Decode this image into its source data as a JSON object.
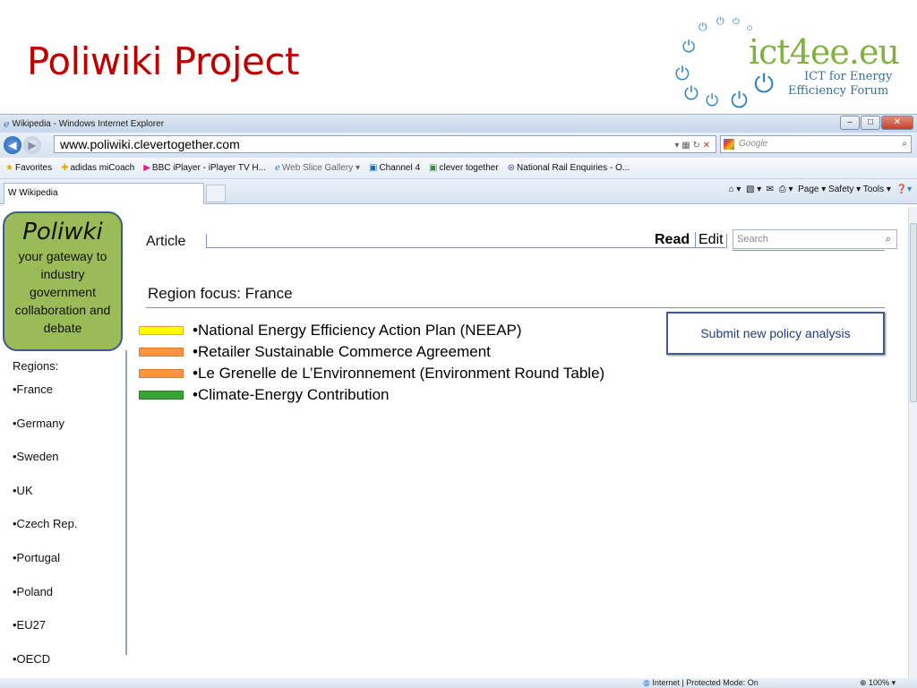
{
  "slide": {
    "title": "Poliwiki Project"
  },
  "logo": {
    "name": "ict4ee.eu",
    "line1": "ICT for Energy",
    "line2": "Efficiency Forum"
  },
  "browser": {
    "window_title": "Wikipedia - Windows Internet Explorer",
    "url": "www.poliwiki.clevertogether.com",
    "search_placeholder": "Google",
    "favorites": [
      "Favorites",
      "adidas miCoach",
      "BBC iPlayer - iPlayer TV H...",
      "Web Slice Gallery ▾",
      "Channel 4",
      "clever together",
      "National Rail Enquiries - O..."
    ],
    "tab_title": "Wikipedia",
    "command_bar": "Page ▾   Safety ▾   Tools ▾",
    "status": "Internet | Protected Mode: On",
    "zoom": "100%"
  },
  "sidebar": {
    "title": "Poliwki",
    "tagline": "your gateway to industry government collaboration and debate",
    "regions_label": "Regions:",
    "regions": [
      "•France",
      "•Germany",
      "•Sweden",
      "•UK",
      "•Czech Rep.",
      "•Portugal",
      "•Poland",
      "•EU27",
      "•OECD"
    ]
  },
  "tabs": {
    "article": "Article",
    "read": "Read",
    "edit": "Edit",
    "search_placeholder": "Search"
  },
  "main": {
    "heading": "Region focus: France",
    "submit_label": "Submit new policy analysis",
    "policies": [
      {
        "label": "•National Energy Efficiency Action Plan (NEEAP)",
        "color": "#ffff00",
        "border": "#e8a33a"
      },
      {
        "label": "•Retailer Sustainable Commerce Agreement",
        "color": "#f79646",
        "border": "#e07a2a"
      },
      {
        "label": "•Le Grenelle de L’Environnement (Environment Round Table)",
        "color": "#f79646",
        "border": "#e07a2a"
      },
      {
        "label": "•Climate-Energy Contribution",
        "color": "#3aa335",
        "border": "#2a7d26"
      }
    ]
  }
}
